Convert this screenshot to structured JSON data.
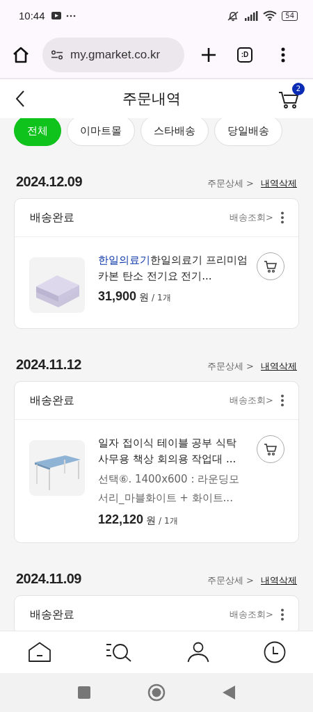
{
  "status_bar": {
    "time": "10:44",
    "battery": "54"
  },
  "browser": {
    "url": "my.gmarket.co.kr",
    "tab_button": ":D"
  },
  "header": {
    "title": "주문내역",
    "cart_count": "2"
  },
  "filters": [
    {
      "label": "전체",
      "selected": true
    },
    {
      "label": "이마트몰",
      "selected": false
    },
    {
      "label": "스타배송",
      "selected": false
    },
    {
      "label": "당일배송",
      "selected": false
    }
  ],
  "orders": [
    {
      "date": "2024.12.09",
      "detail_link": "주문상세 >",
      "delete_link": "내역삭제",
      "status": "배송완료",
      "tracking": "배송조회>",
      "items": [
        {
          "kind": "pad",
          "brand": "한일의료기",
          "name": "한일의료기 프리미엄 카본 탄소 전기요 전기...",
          "price": "31,900",
          "unit": "원",
          "quantity": "/ 1개"
        }
      ]
    },
    {
      "date": "2024.11.12",
      "detail_link": "주문상세 >",
      "delete_link": "내역삭제",
      "status": "배송완료",
      "tracking": "배송조회>",
      "items": [
        {
          "kind": "table",
          "name": "일자 접이식 테이블 공부 식탁 사무용 책상 회의용 작업대 ...",
          "option": "선택⑥. 1400x600 : 라운딩모서리_마블화이트 + 화이트...",
          "price": "122,120",
          "unit": "원",
          "quantity": "/ 1개"
        }
      ]
    },
    {
      "date": "2024.11.09",
      "detail_link": "주문상세 >",
      "delete_link": "내역삭제",
      "status": "배송완료",
      "tracking": "배송조회>"
    }
  ]
}
